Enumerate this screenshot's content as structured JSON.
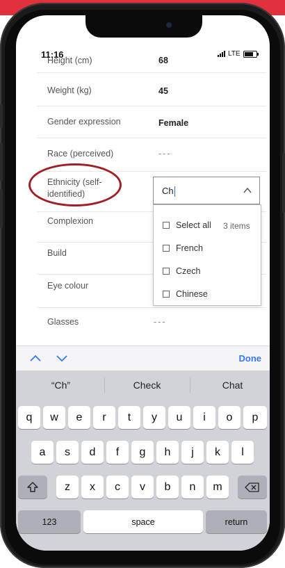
{
  "status_bar": {
    "time": "11:16",
    "network": "LTE"
  },
  "form": {
    "rows": [
      {
        "label": "Height (cm)",
        "value": "68"
      },
      {
        "label": "Weight (kg)",
        "value": "45"
      },
      {
        "label": "Gender expression",
        "value": "Female"
      },
      {
        "label": "Race (perceived)",
        "value": "---"
      },
      {
        "label": "Ethnicity (self-identified)",
        "label_line1": "Ethnicity (self-",
        "label_line2": "identified)"
      },
      {
        "label": "Complexion"
      },
      {
        "label": "Build"
      },
      {
        "label": "Eye colour"
      },
      {
        "label": "Glasses",
        "value": "---"
      }
    ]
  },
  "ethnicity_combo": {
    "input_value": "Ch",
    "select_all_label": "Select all",
    "items_count": "3 items",
    "options": [
      "French",
      "Czech",
      "Chinese"
    ]
  },
  "keyboard_accessory": {
    "done_label": "Done"
  },
  "keyboard": {
    "suggestions": [
      "“Ch”",
      "Check",
      "Chat"
    ],
    "row1": [
      "q",
      "w",
      "e",
      "r",
      "t",
      "y",
      "u",
      "i",
      "o",
      "p"
    ],
    "row2": [
      "a",
      "s",
      "d",
      "f",
      "g",
      "h",
      "j",
      "k",
      "l"
    ],
    "row3": [
      "z",
      "x",
      "c",
      "v",
      "b",
      "n",
      "m"
    ],
    "numbers_label": "123",
    "space_label": "space",
    "return_label": "return"
  },
  "colors": {
    "top_bar": "#e0313c",
    "highlight": "#a11e24",
    "ios_blue": "#3478f6",
    "keyboard_bg": "#d1d3d9"
  }
}
